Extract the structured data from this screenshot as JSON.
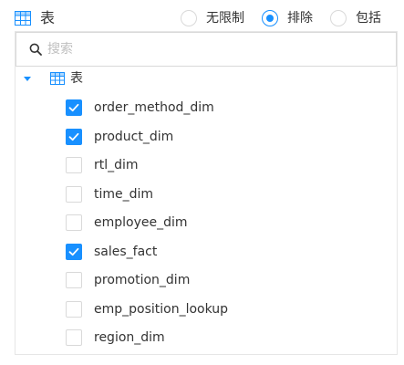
{
  "header": {
    "icon": "table-icon",
    "title": "表",
    "filter_options": [
      {
        "label": "无限制",
        "checked": false
      },
      {
        "label": "排除",
        "checked": true
      },
      {
        "label": "包括",
        "checked": false
      }
    ]
  },
  "search": {
    "icon": "search-icon",
    "placeholder": "搜索",
    "value": ""
  },
  "tree": {
    "root_label": "表",
    "root_icon": "table-icon",
    "expanded": true,
    "items": [
      {
        "label": "order_method_dim",
        "checked": true
      },
      {
        "label": "product_dim",
        "checked": true
      },
      {
        "label": "rtl_dim",
        "checked": false
      },
      {
        "label": "time_dim",
        "checked": false
      },
      {
        "label": "employee_dim",
        "checked": false
      },
      {
        "label": "sales_fact",
        "checked": true
      },
      {
        "label": "promotion_dim",
        "checked": false
      },
      {
        "label": "emp_position_lookup",
        "checked": false
      },
      {
        "label": "region_dim",
        "checked": false
      }
    ]
  },
  "colors": {
    "accent": "#1890ff",
    "border": "#d9d9d9",
    "text": "#333333",
    "placeholder": "#bfbfbf"
  }
}
